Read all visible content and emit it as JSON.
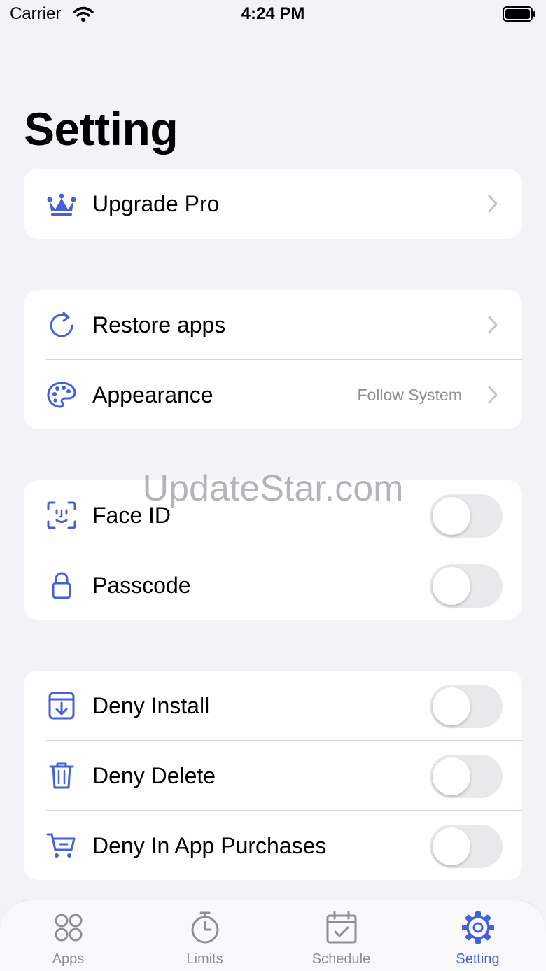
{
  "status_bar": {
    "carrier": "Carrier",
    "time": "4:24 PM"
  },
  "page_title": "Setting",
  "colors": {
    "accent": "#4361d8",
    "background": "#f2f2f7",
    "secondary_text": "#8e8e93"
  },
  "upgrade": {
    "label": "Upgrade Pro",
    "icon": "crown-icon"
  },
  "general": {
    "restore_label": "Restore apps",
    "appearance_label": "Appearance",
    "appearance_value": "Follow System"
  },
  "security": {
    "face_id_label": "Face ID",
    "face_id_on": false,
    "passcode_label": "Passcode",
    "passcode_on": false
  },
  "restrictions": {
    "deny_install_label": "Deny Install",
    "deny_install_on": false,
    "deny_delete_label": "Deny Delete",
    "deny_delete_on": false,
    "deny_iap_label": "Deny In App Purchases",
    "deny_iap_on": false
  },
  "watermark": "UpdateStar.com",
  "tabs": [
    {
      "label": "Apps",
      "icon": "apps-grid-icon",
      "active": false
    },
    {
      "label": "Limits",
      "icon": "timer-icon",
      "active": false
    },
    {
      "label": "Schedule",
      "icon": "calendar-check-icon",
      "active": false
    },
    {
      "label": "Setting",
      "icon": "gear-icon",
      "active": true
    }
  ]
}
